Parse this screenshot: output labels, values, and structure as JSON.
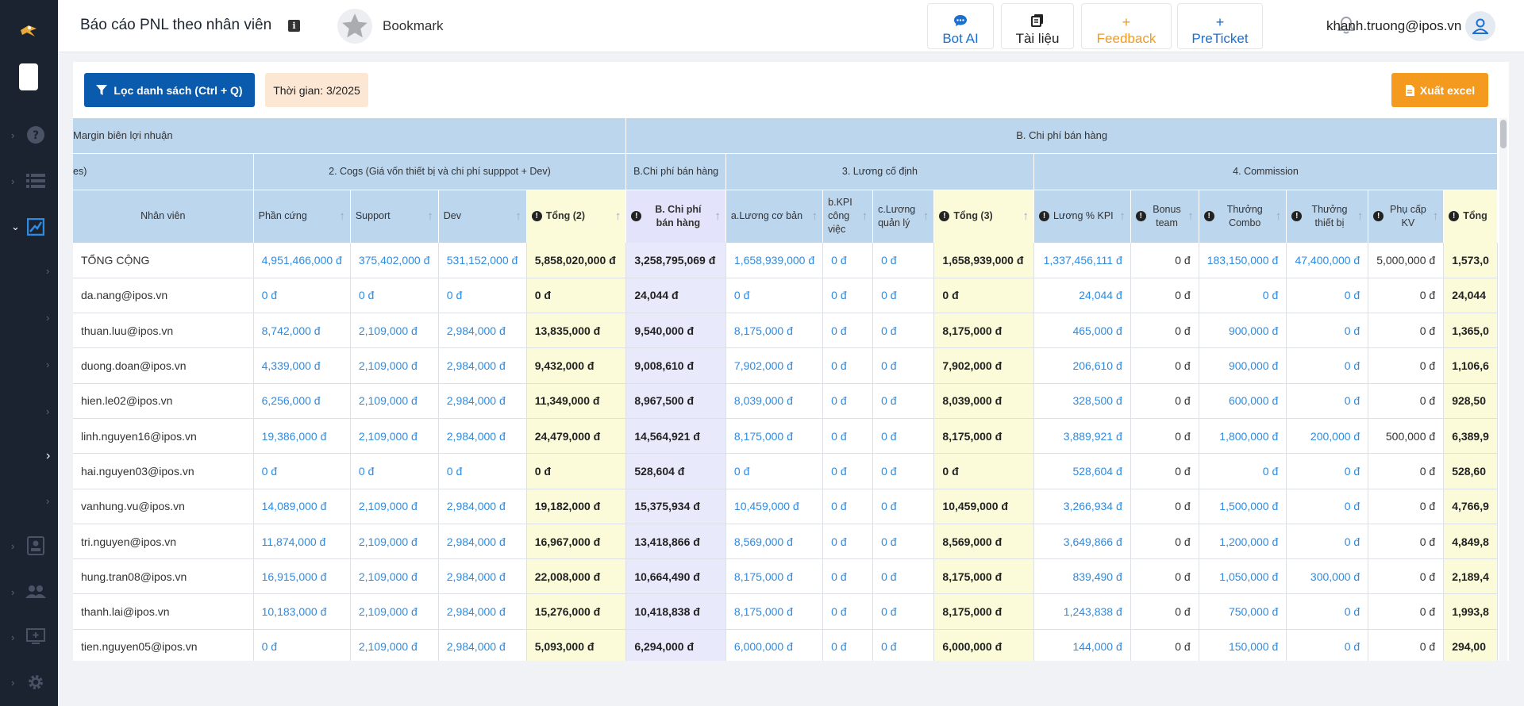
{
  "header": {
    "title": "Báo cáo PNL theo nhân viên",
    "bookmark": "Bookmark",
    "buttons": [
      {
        "label": "Bot AI",
        "icon": "chat-bubble-icon",
        "color": "#1a6fd1"
      },
      {
        "label": "Tài liệu",
        "icon": "document-icon",
        "color": "#222222"
      },
      {
        "label": "Feedback",
        "icon": "plus-icon",
        "color": "#f39a1f"
      },
      {
        "label": "PreTicket",
        "icon": "plus-icon",
        "color": "#1a6fd1"
      }
    ],
    "user_email": "khanh.truong@ipos.vn"
  },
  "toolbar": {
    "filter_label": "Lọc danh sách (Ctrl + Q)",
    "time_label": "Thời gian: 3/2025",
    "export_label": "Xuất excel"
  },
  "colors": {
    "sidebar_bg": "#1b2230",
    "primary": "#0a5aad",
    "export": "#f39a1f",
    "header_cell": "#bcd6ee",
    "total_col": "#fbfbd9",
    "sell_col": "#e3e4fb",
    "link_value": "#2f8be0"
  },
  "table": {
    "group1": [
      "Margin biên lợi nhuận",
      "B. Chi phí bán hàng"
    ],
    "group2": [
      "es)",
      "2. Cogs (Giá vốn thiết bị và chi phí supppot + Dev)",
      "B.Chi phí bán hàng",
      "3. Lương cố định",
      "4. Commission"
    ],
    "columns": [
      "Nhân viên",
      "Phần cứng",
      "Support",
      "Dev",
      "Tổng (2)",
      "B. Chi phí bán hàng",
      "a.Lương cơ bản",
      "b.KPI công việc",
      "c.Lương quản lý",
      "Tổng (3)",
      "Lương % KPI",
      "Bonus team",
      "Thưởng Combo",
      "Thưởng thiết bị",
      "Phụ cấp KV",
      "Tổng"
    ],
    "rows": [
      [
        "TỔNG CỘNG",
        "4,951,466,000 đ",
        "375,402,000 đ",
        "531,152,000 đ",
        "5,858,020,000 đ",
        "3,258,795,069 đ",
        "1,658,939,000 đ",
        "0 đ",
        "0 đ",
        "1,658,939,000 đ",
        "1,337,456,111 đ",
        "0 đ",
        "183,150,000 đ",
        "47,400,000 đ",
        "5,000,000 đ",
        "1,573,0"
      ],
      [
        "da.nang@ipos.vn",
        "0 đ",
        "0 đ",
        "0 đ",
        "0 đ",
        "24,044 đ",
        "0 đ",
        "0 đ",
        "0 đ",
        "0 đ",
        "24,044 đ",
        "0 đ",
        "0 đ",
        "0 đ",
        "0 đ",
        "24,044"
      ],
      [
        "thuan.luu@ipos.vn",
        "8,742,000 đ",
        "2,109,000 đ",
        "2,984,000 đ",
        "13,835,000 đ",
        "9,540,000 đ",
        "8,175,000 đ",
        "0 đ",
        "0 đ",
        "8,175,000 đ",
        "465,000 đ",
        "0 đ",
        "900,000 đ",
        "0 đ",
        "0 đ",
        "1,365,0"
      ],
      [
        "duong.doan@ipos.vn",
        "4,339,000 đ",
        "2,109,000 đ",
        "2,984,000 đ",
        "9,432,000 đ",
        "9,008,610 đ",
        "7,902,000 đ",
        "0 đ",
        "0 đ",
        "7,902,000 đ",
        "206,610 đ",
        "0 đ",
        "900,000 đ",
        "0 đ",
        "0 đ",
        "1,106,6"
      ],
      [
        "hien.le02@ipos.vn",
        "6,256,000 đ",
        "2,109,000 đ",
        "2,984,000 đ",
        "11,349,000 đ",
        "8,967,500 đ",
        "8,039,000 đ",
        "0 đ",
        "0 đ",
        "8,039,000 đ",
        "328,500 đ",
        "0 đ",
        "600,000 đ",
        "0 đ",
        "0 đ",
        "928,50"
      ],
      [
        "linh.nguyen16@ipos.vn",
        "19,386,000 đ",
        "2,109,000 đ",
        "2,984,000 đ",
        "24,479,000 đ",
        "14,564,921 đ",
        "8,175,000 đ",
        "0 đ",
        "0 đ",
        "8,175,000 đ",
        "3,889,921 đ",
        "0 đ",
        "1,800,000 đ",
        "200,000 đ",
        "500,000 đ",
        "6,389,9"
      ],
      [
        "hai.nguyen03@ipos.vn",
        "0 đ",
        "0 đ",
        "0 đ",
        "0 đ",
        "528,604 đ",
        "0 đ",
        "0 đ",
        "0 đ",
        "0 đ",
        "528,604 đ",
        "0 đ",
        "0 đ",
        "0 đ",
        "0 đ",
        "528,60"
      ],
      [
        "vanhung.vu@ipos.vn",
        "14,089,000 đ",
        "2,109,000 đ",
        "2,984,000 đ",
        "19,182,000 đ",
        "15,375,934 đ",
        "10,459,000 đ",
        "0 đ",
        "0 đ",
        "10,459,000 đ",
        "3,266,934 đ",
        "0 đ",
        "1,500,000 đ",
        "0 đ",
        "0 đ",
        "4,766,9"
      ],
      [
        "tri.nguyen@ipos.vn",
        "11,874,000 đ",
        "2,109,000 đ",
        "2,984,000 đ",
        "16,967,000 đ",
        "13,418,866 đ",
        "8,569,000 đ",
        "0 đ",
        "0 đ",
        "8,569,000 đ",
        "3,649,866 đ",
        "0 đ",
        "1,200,000 đ",
        "0 đ",
        "0 đ",
        "4,849,8"
      ],
      [
        "hung.tran08@ipos.vn",
        "16,915,000 đ",
        "2,109,000 đ",
        "2,984,000 đ",
        "22,008,000 đ",
        "10,664,490 đ",
        "8,175,000 đ",
        "0 đ",
        "0 đ",
        "8,175,000 đ",
        "839,490 đ",
        "0 đ",
        "1,050,000 đ",
        "300,000 đ",
        "0 đ",
        "2,189,4"
      ],
      [
        "thanh.lai@ipos.vn",
        "10,183,000 đ",
        "2,109,000 đ",
        "2,984,000 đ",
        "15,276,000 đ",
        "10,418,838 đ",
        "8,175,000 đ",
        "0 đ",
        "0 đ",
        "8,175,000 đ",
        "1,243,838 đ",
        "0 đ",
        "750,000 đ",
        "0 đ",
        "0 đ",
        "1,993,8"
      ],
      [
        "tien.nguyen05@ipos.vn",
        "0 đ",
        "2,109,000 đ",
        "2,984,000 đ",
        "5,093,000 đ",
        "6,294,000 đ",
        "6,000,000 đ",
        "0 đ",
        "0 đ",
        "6,000,000 đ",
        "144,000 đ",
        "0 đ",
        "150,000 đ",
        "0 đ",
        "0 đ",
        "294,00"
      ]
    ]
  }
}
